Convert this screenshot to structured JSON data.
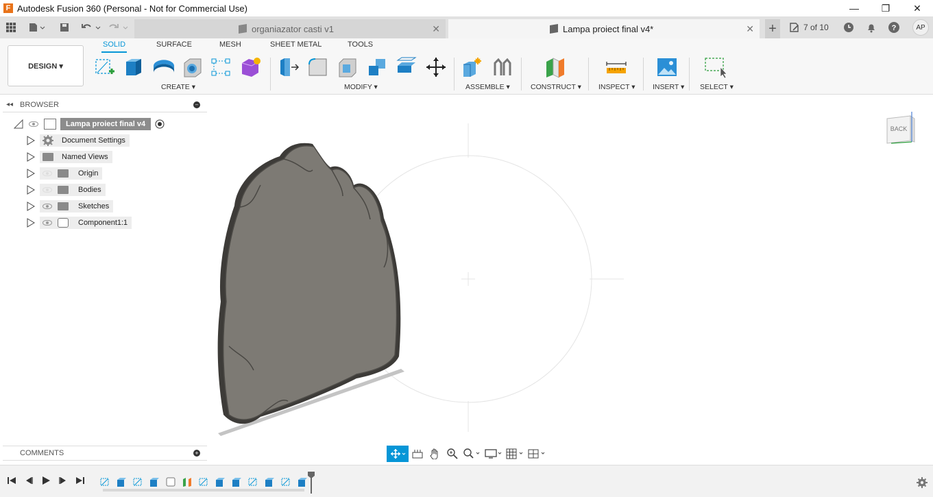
{
  "window": {
    "title": "Autodesk Fusion 360 (Personal - Not for Commercial Use)",
    "app_icon_letter": "F",
    "minimize": "—",
    "restore": "❐",
    "close": "✕"
  },
  "tabs": [
    {
      "label": "organiazator casti v1",
      "active": false
    },
    {
      "label": "Lampa proiect final v4*",
      "active": true
    }
  ],
  "tabbar": {
    "new_tab": "+",
    "count": "7 of 10",
    "avatar": "AP",
    "tab_close": "✕"
  },
  "toolbar": {
    "workspace": "DESIGN ▾",
    "workspace_tabs": [
      "SOLID",
      "SURFACE",
      "MESH",
      "SHEET METAL",
      "TOOLS"
    ],
    "groups": {
      "create": "CREATE ▾",
      "modify": "MODIFY ▾",
      "assemble": "ASSEMBLE ▾",
      "construct": "CONSTRUCT ▾",
      "inspect": "INSPECT ▾",
      "insert": "INSERT ▾",
      "select": "SELECT ▾"
    }
  },
  "browser": {
    "title": "BROWSER",
    "root": "Lampa proiect final v4",
    "items": [
      {
        "label": "Document Settings",
        "icon": "gear-icon"
      },
      {
        "label": "Named Views",
        "icon": "folder-icon"
      },
      {
        "label": "Origin",
        "icon": "folder-icon",
        "visible": false
      },
      {
        "label": "Bodies",
        "icon": "folder-icon",
        "visible": false
      },
      {
        "label": "Sketches",
        "icon": "folder-icon",
        "visible": true
      },
      {
        "label": "Component1:1",
        "icon": "component-icon",
        "visible": true
      }
    ]
  },
  "comments": {
    "title": "COMMENTS"
  },
  "viewcube": {
    "face": "BACK",
    "axis": "Z"
  },
  "colors": {
    "accent": "#0696d7",
    "body": "#7d7a74",
    "ribbon_bg": "#f7f7f7"
  }
}
